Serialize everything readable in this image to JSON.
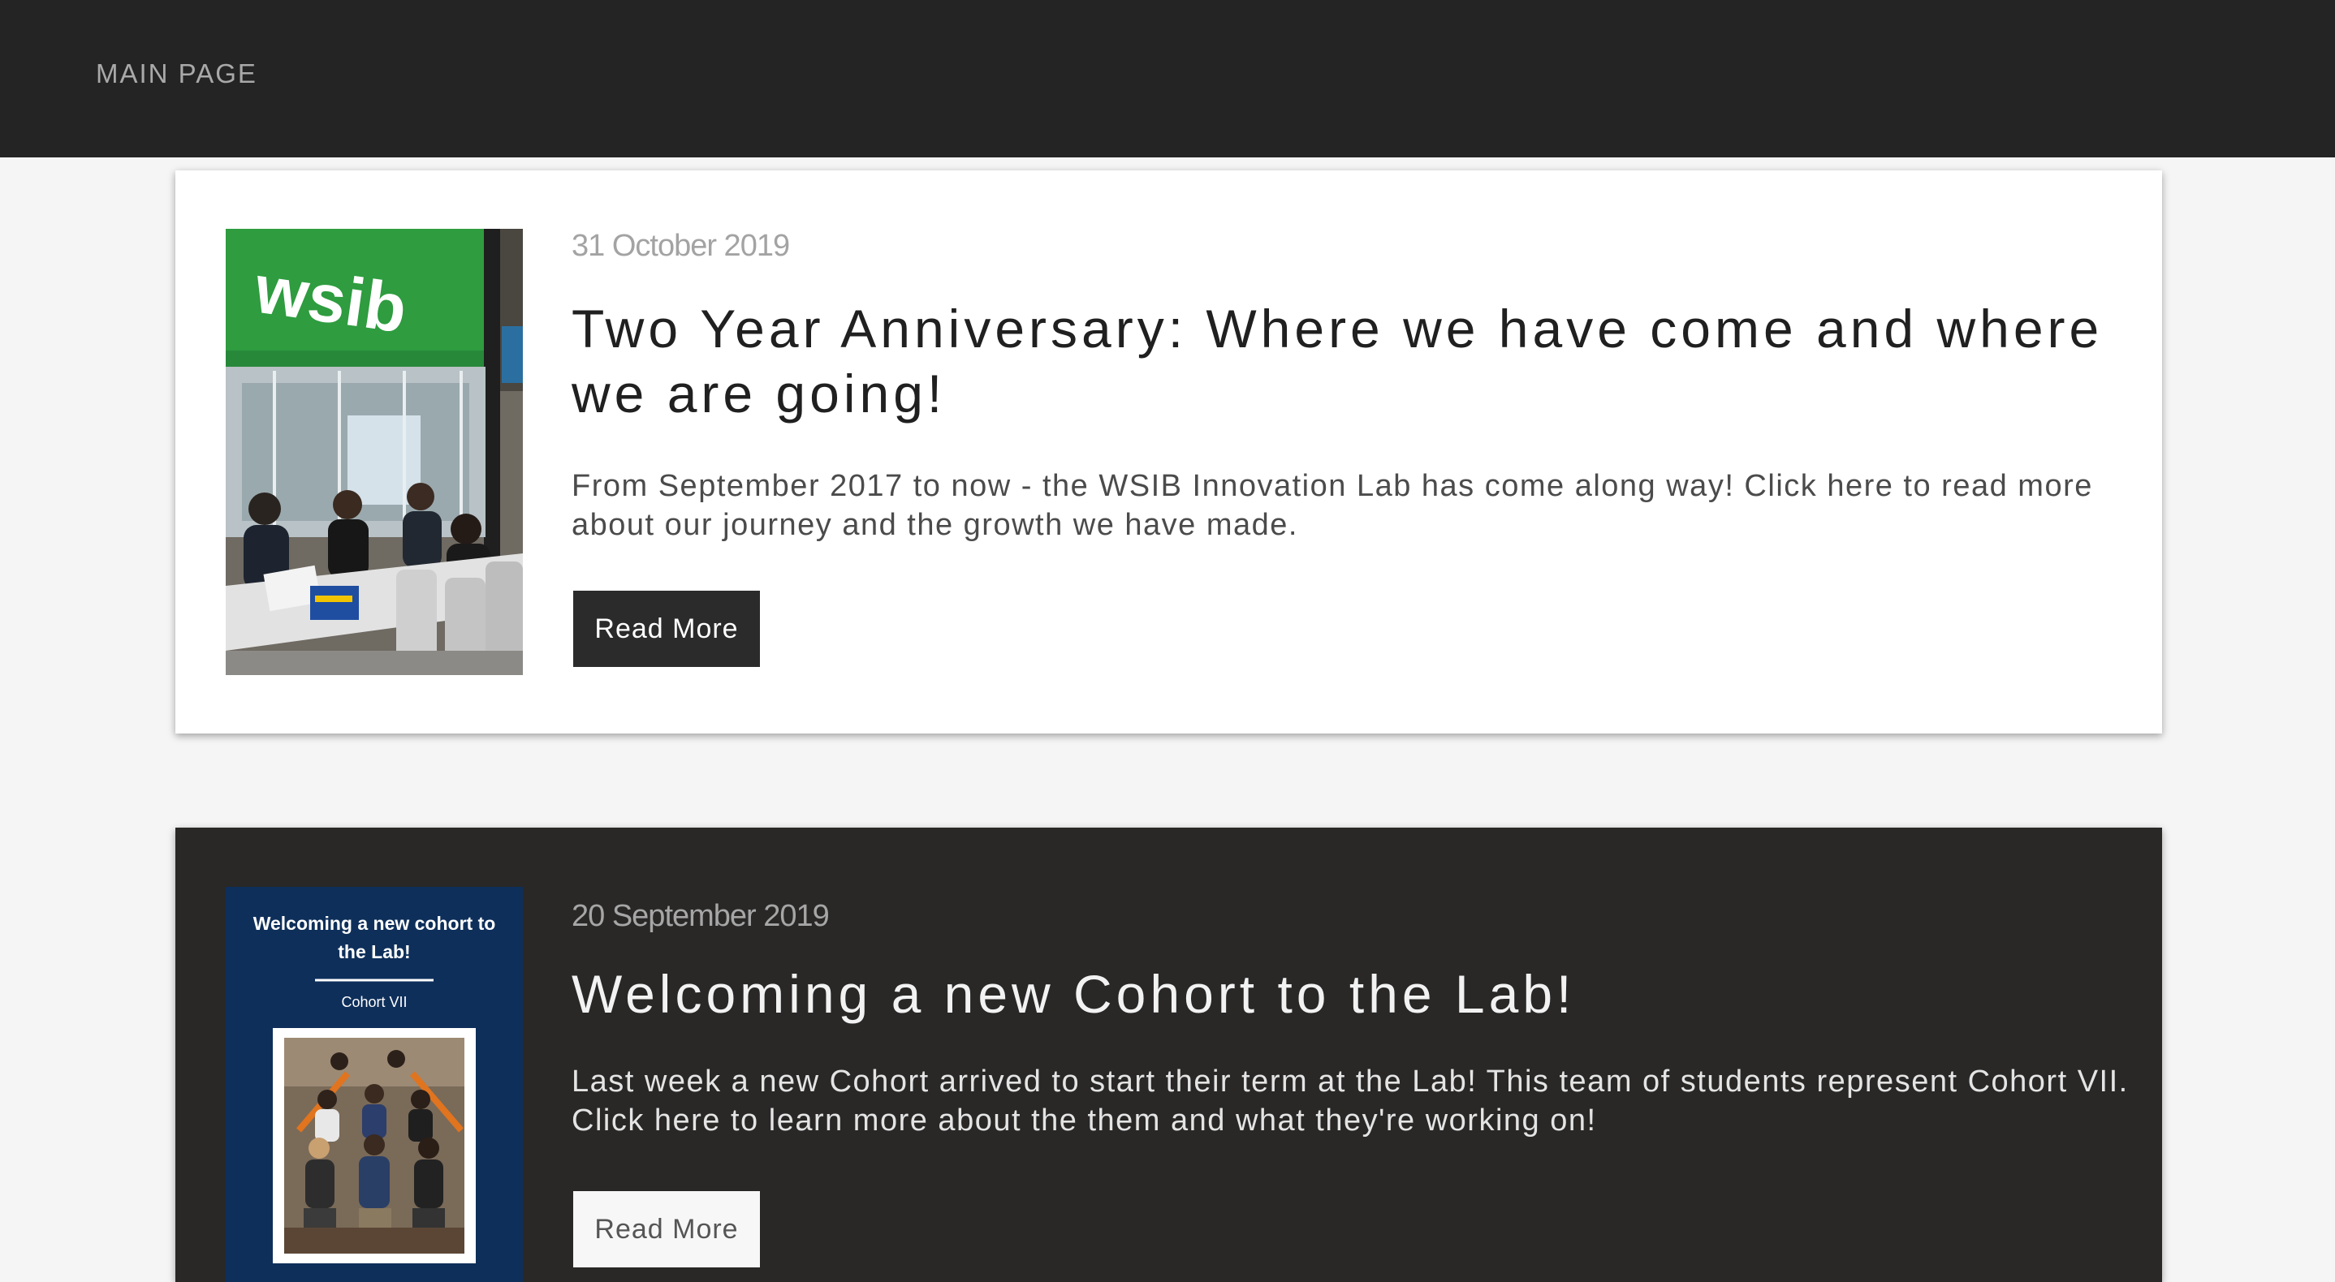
{
  "nav": {
    "main_page": "MAIN PAGE"
  },
  "posts": [
    {
      "date": "31 October 2019",
      "title": "Two Year Anniversary: Where we have come and where we are going!",
      "description": "From September 2017 to now - the WSIB Innovation Lab has come along way! Click here to read more about our journey and the growth we have made.",
      "button": "Read More",
      "image": {
        "sign_text": "wsib"
      }
    },
    {
      "date": "20 September 2019",
      "title": "Welcoming a new Cohort to the Lab!",
      "description": "Last week a new Cohort arrived to start their term at the Lab! This team of students represent Cohort VII. Click here to learn more about the them and what they're working on!",
      "button": "Read More",
      "image": {
        "heading": "Welcoming a new cohort to the Lab!",
        "subheading": "Cohort VII"
      }
    }
  ],
  "colors": {
    "topbar": "#242424",
    "page_background": "#f5f5f5",
    "dark_card": "#292827",
    "wsib_green": "#2e9c3f",
    "cohort_navy": "#0e2f5a"
  }
}
